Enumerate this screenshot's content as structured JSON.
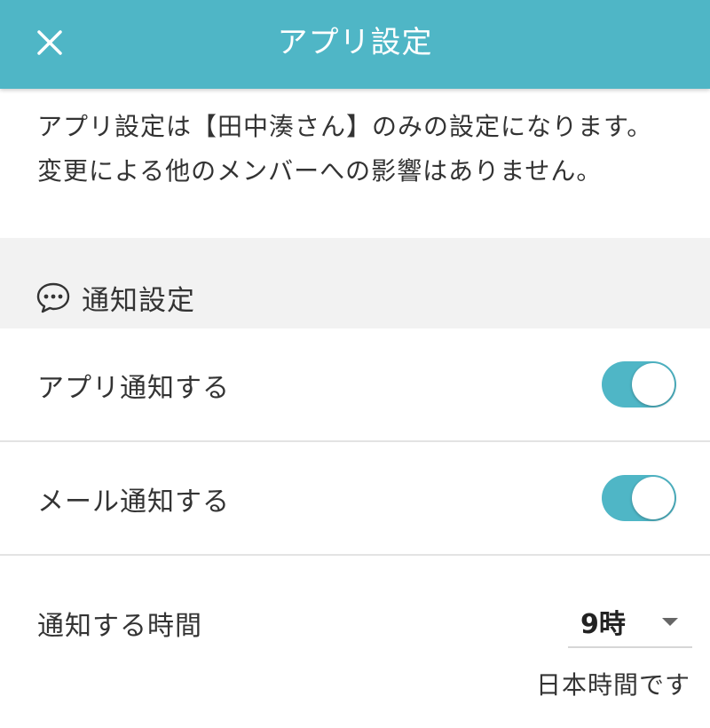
{
  "header": {
    "title": "アプリ設定",
    "close_icon": "close-icon",
    "background_color": "#4fb6c6"
  },
  "notice": {
    "text": "アプリ設定は【田中湊さん】のみの設定になります。変更による他のメンバーへの影響はありません。"
  },
  "notification_section": {
    "icon": "chat-bubble-icon",
    "title": "通知設定"
  },
  "settings": {
    "app_notification": {
      "label": "アプリ通知する",
      "enabled": true
    },
    "mail_notification": {
      "label": "メール通知する",
      "enabled": true
    },
    "notify_time": {
      "label": "通知する時間",
      "selected_value": "9時",
      "note": "日本時間です"
    }
  },
  "colors": {
    "accent": "#4fb6c6",
    "section_band": "#f2f2f2",
    "divider": "#e3e3e3"
  }
}
